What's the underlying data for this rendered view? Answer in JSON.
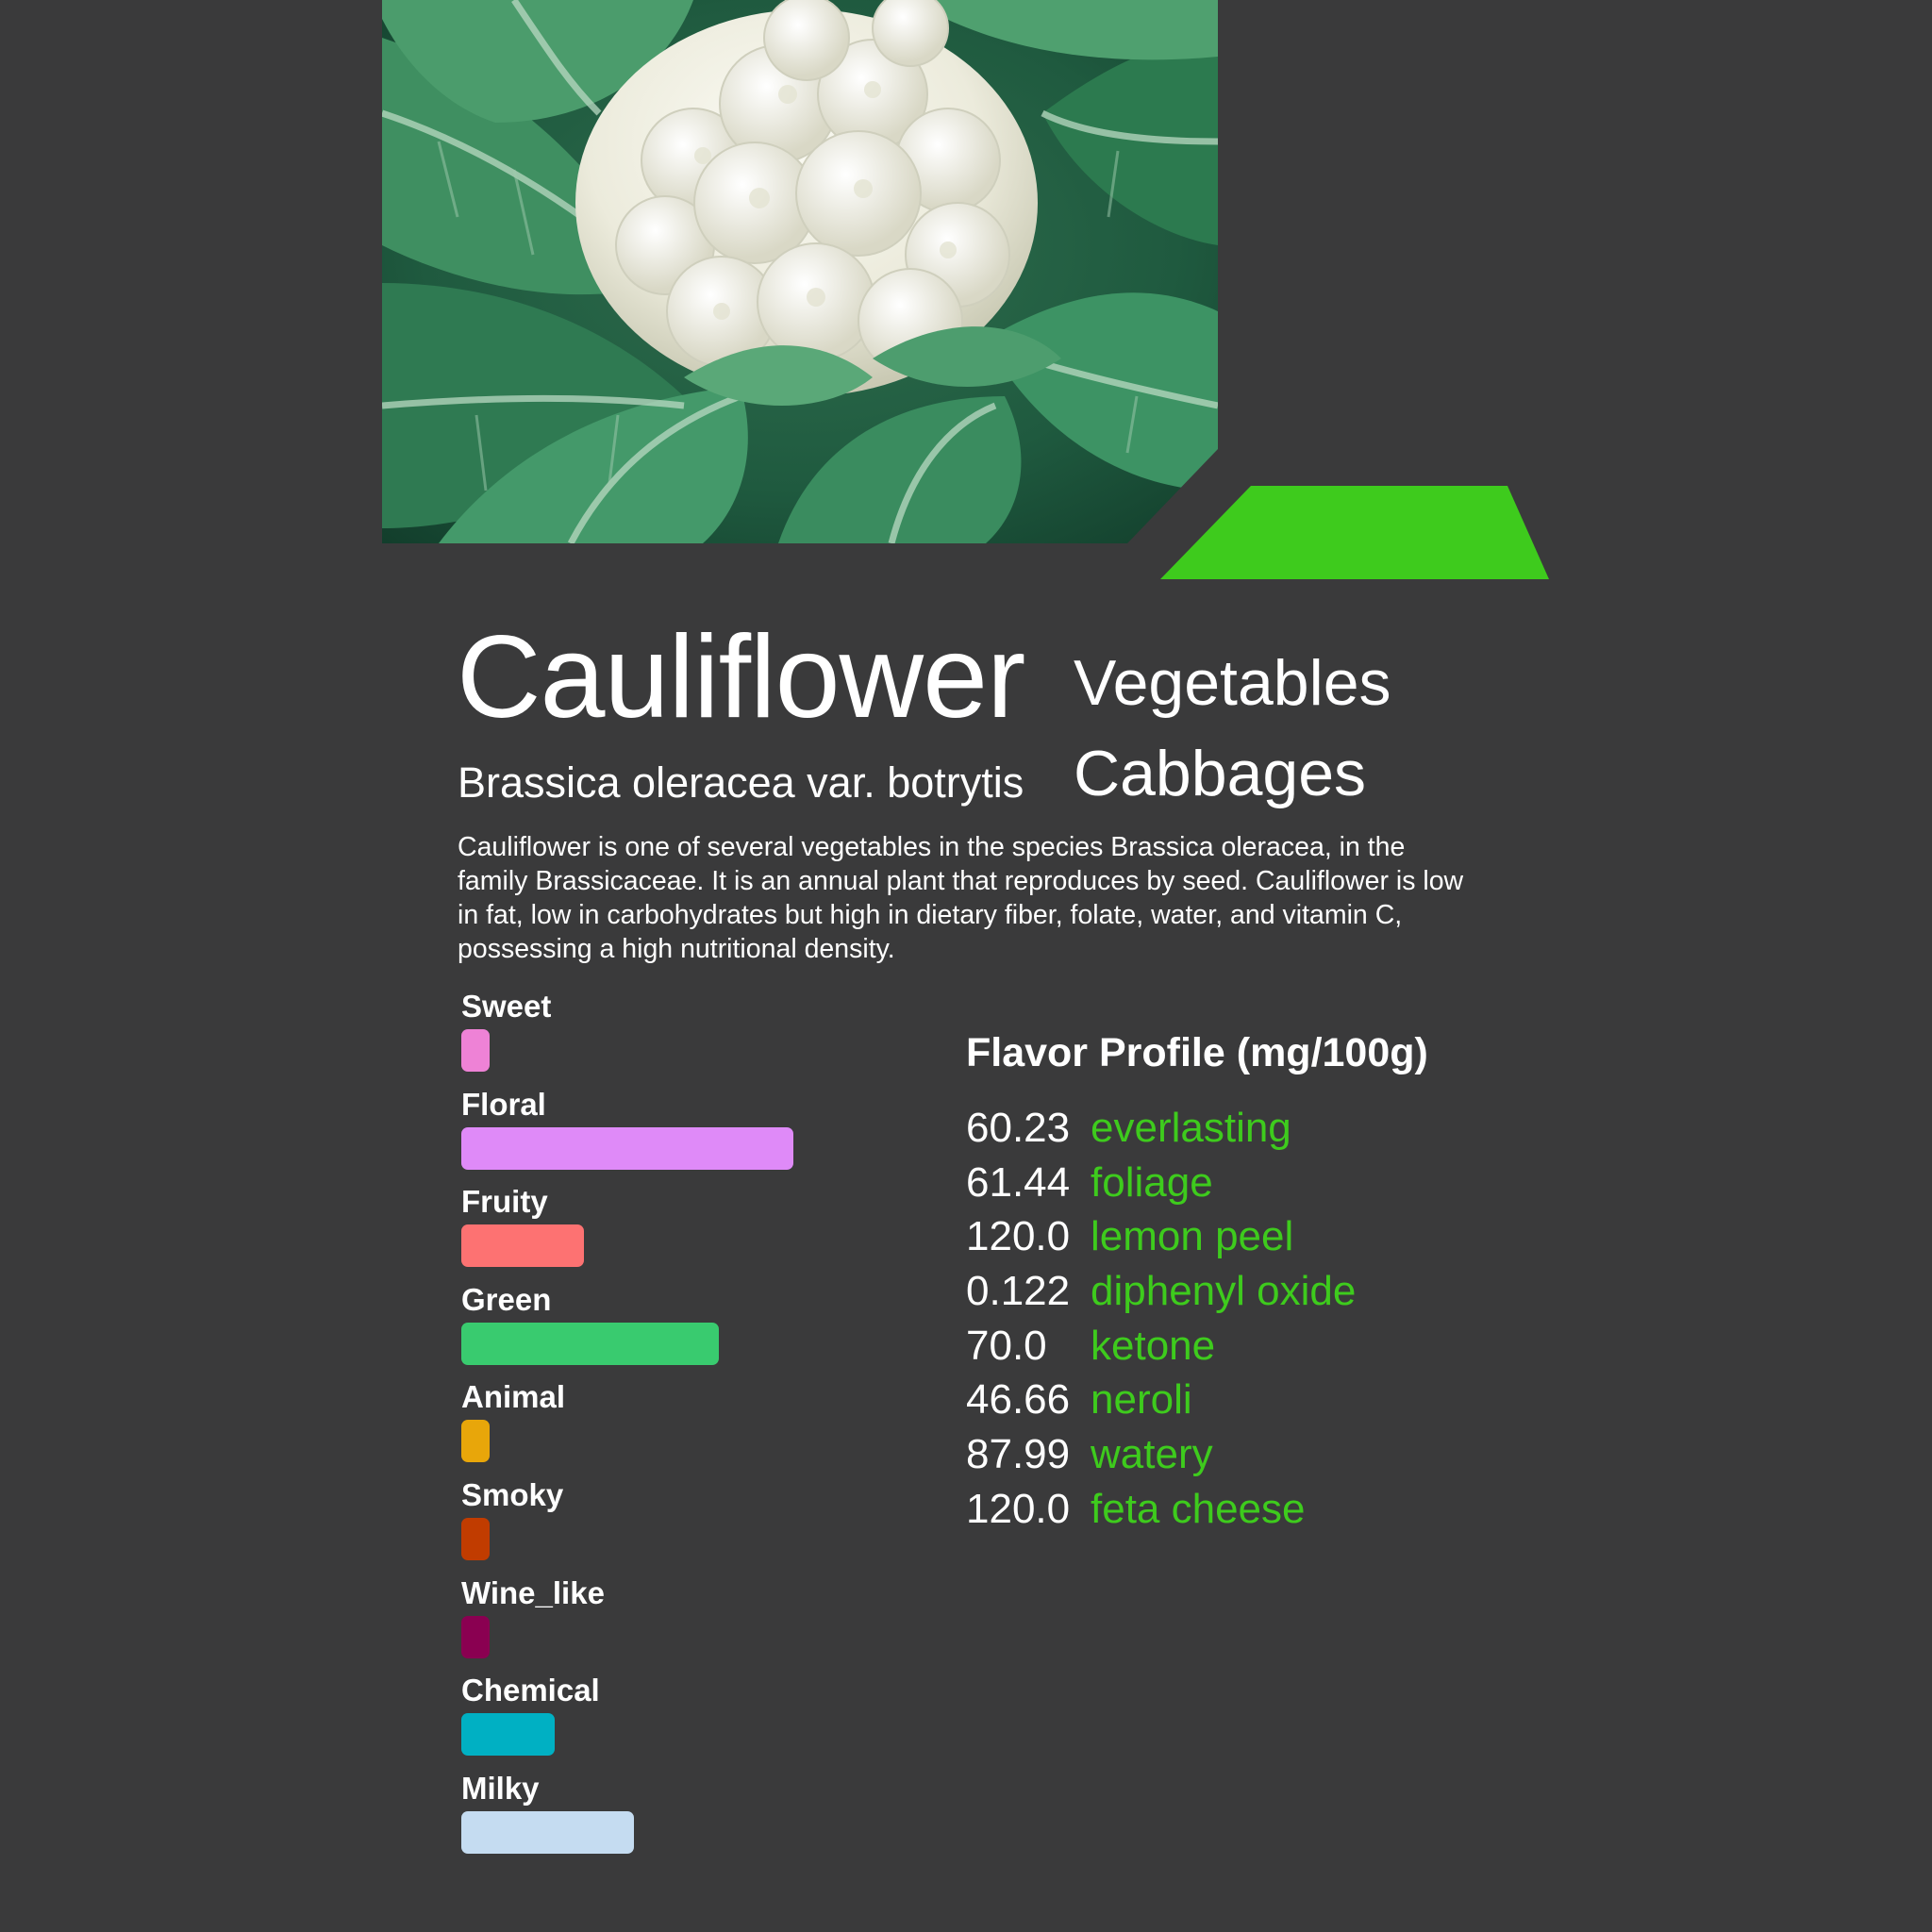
{
  "colors": {
    "background": "#3a3a3b",
    "accent": "#3ecb1d",
    "text": "#ffffff"
  },
  "food": {
    "name": "Cauliflower",
    "scientific_name": "Brassica oleracea var. botrytis",
    "category": "Vegetables",
    "subcategory": "Cabbages",
    "description": "Cauliflower is one of several vegetables in the species Brassica oleracea, in the family Brassicaceae. It is an annual plant that reproduces by seed. Cauliflower is low in fat, low in carbohydrates but high in dietary fiber, folate, water, and vitamin C, possessing a high nutritional density."
  },
  "flavor_bars": {
    "scale_max": 10,
    "items": [
      {
        "label": "Sweet",
        "value": 0.85,
        "color": "#ee82d6"
      },
      {
        "label": "Floral",
        "value": 10.0,
        "color": "#df8af8"
      },
      {
        "label": "Fruity",
        "value": 3.7,
        "color": "#fd7272"
      },
      {
        "label": "Green",
        "value": 7.75,
        "color": "#39cb6f"
      },
      {
        "label": "Animal",
        "value": 0.85,
        "color": "#e8a60a"
      },
      {
        "label": "Smoky",
        "value": 0.85,
        "color": "#c13c00"
      },
      {
        "label": "Wine_like",
        "value": 0.85,
        "color": "#8a0051"
      },
      {
        "label": "Chemical",
        "value": 2.8,
        "color": "#00b0c3"
      },
      {
        "label": "Milky",
        "value": 5.2,
        "color": "#c5dcf1"
      }
    ]
  },
  "flavor_profile": {
    "title": "Flavor Profile (mg/100g)",
    "items": [
      {
        "value": "60.23",
        "name": "everlasting"
      },
      {
        "value": "61.44",
        "name": "foliage"
      },
      {
        "value": "120.0",
        "name": "lemon peel"
      },
      {
        "value": "0.122",
        "name": "diphenyl oxide"
      },
      {
        "value": "70.0",
        "name": "ketone"
      },
      {
        "value": "46.66",
        "name": "neroli"
      },
      {
        "value": "87.99",
        "name": "watery"
      },
      {
        "value": "120.0",
        "name": "feta cheese"
      }
    ]
  }
}
